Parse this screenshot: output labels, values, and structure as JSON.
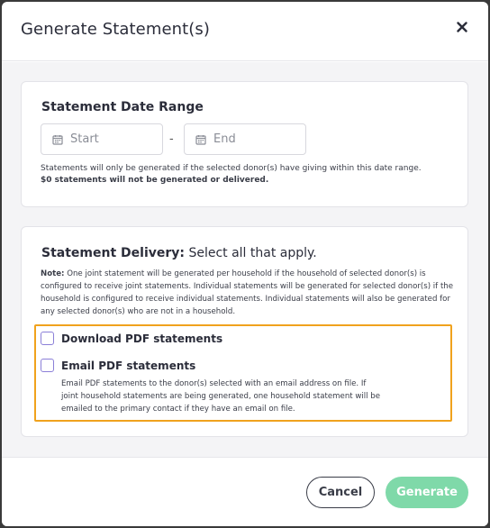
{
  "modal": {
    "title": "Generate Statement(s)",
    "close_icon": "close-icon"
  },
  "date_range": {
    "title": "Statement Date Range",
    "start_placeholder": "Start",
    "end_placeholder": "End",
    "separator": "-",
    "help_line1": "Statements will only be generated if the selected donor(s) have giving within this date range.",
    "help_line2": "$0 statements will not be generated or delivered.",
    "calendar_icon": "calendar-icon"
  },
  "delivery": {
    "title_bold": "Statement Delivery:",
    "title_normal": " Select all that apply.",
    "note_label": "Note:",
    "note_text": " One joint statement will be generated per household if the household of selected donor(s) is configured to receive joint statements. Individual statements will be generated for selected donor(s) if the household is configured to receive individual statements. Individual statements will also be generated for any selected donor(s) who are not in a household.",
    "options": [
      {
        "label": "Download PDF statements",
        "checked": false
      },
      {
        "label": "Email PDF statements",
        "checked": false
      }
    ],
    "email_description": "Email PDF statements to the donor(s) selected with an email address on file. If joint household statements are being generated, one household statement will be emailed to the primary contact if they have an email on file."
  },
  "footer": {
    "cancel_label": "Cancel",
    "generate_label": "Generate"
  },
  "colors": {
    "highlight": "#f0a21d",
    "checkbox_border": "#8b7fd8",
    "generate_button": "#7fd9a9",
    "body_background": "#f4f4f6"
  }
}
